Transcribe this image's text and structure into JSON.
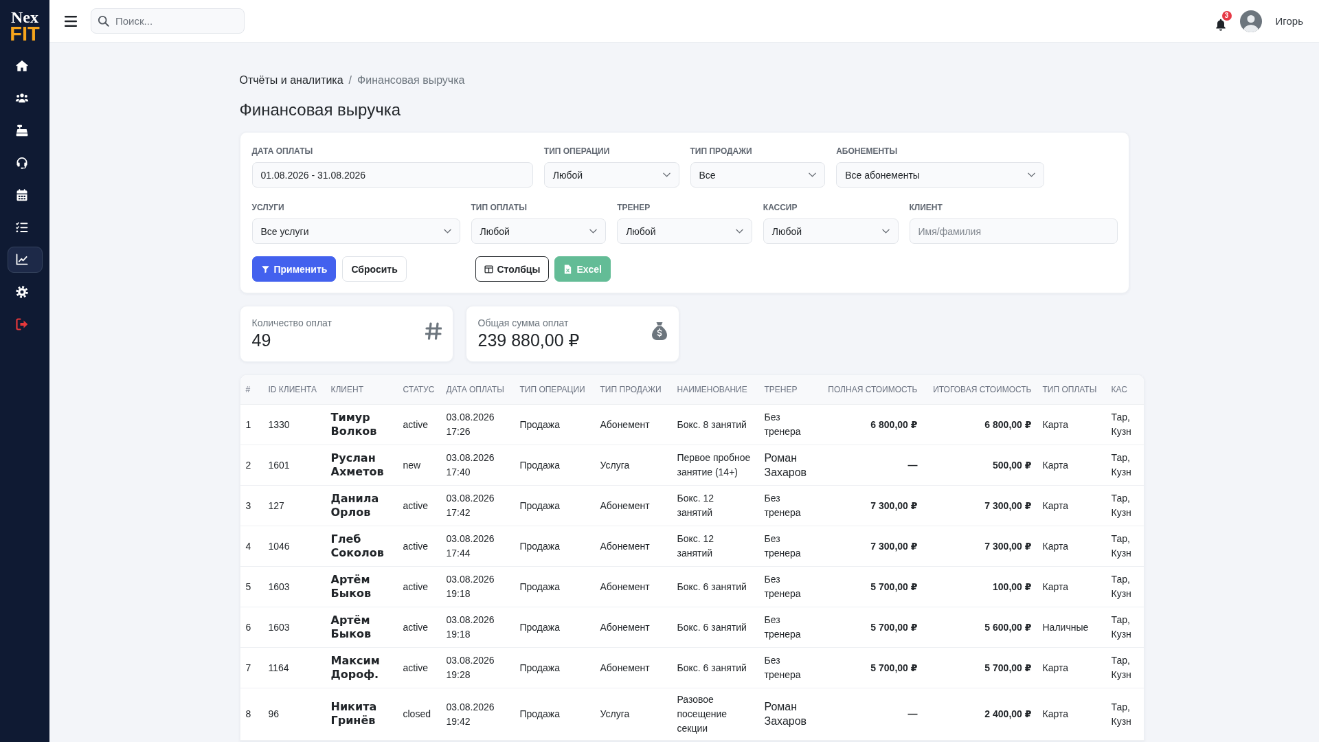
{
  "sidebar": {
    "logo": {
      "line_1": "Nex",
      "line_2": "FIT"
    },
    "items": [
      {
        "kind": "nav",
        "selected": false
      },
      {
        "kind": "nav",
        "selected": false
      },
      {
        "kind": "nav",
        "selected": false
      },
      {
        "kind": "nav",
        "selected": false
      },
      {
        "kind": "nav",
        "selected": false
      },
      {
        "kind": "nav",
        "selected": false
      },
      {
        "kind": "nav",
        "selected": true
      },
      {
        "kind": "nav",
        "selected": false
      },
      {
        "kind": "exit",
        "selected": false
      }
    ]
  },
  "header": {
    "search": {
      "placeholder": "Поиск..."
    },
    "notifications": {
      "count": "3"
    },
    "user": {
      "name": "Игорь"
    }
  },
  "breadcrumb": {
    "items": [
      "Отчёты и аналитика",
      "Финансовая выручка"
    ],
    "separator": "/"
  },
  "title": "Финансовая выручка",
  "filters": {
    "rows": [
      [
        {
          "label": "ДАТА ОПЛАТЫ",
          "kind": "input",
          "value": "01.08.2026 - 31.08.2026"
        },
        {
          "label": "ТИП ОПЕРАЦИИ",
          "kind": "select",
          "value": "Любой"
        },
        {
          "label": "ТИП ПРОДАЖИ",
          "kind": "select",
          "value": "Все"
        },
        {
          "label": "АБОНЕМЕНТЫ",
          "kind": "select",
          "value": "Все абонементы"
        }
      ],
      [
        {
          "label": "УСЛУГИ",
          "kind": "select",
          "value": "Все услуги"
        },
        {
          "label": "ТИП ОПЛАТЫ",
          "kind": "select",
          "value": "Любой"
        },
        {
          "label": "ТРЕНЕР",
          "kind": "select",
          "value": "Любой"
        },
        {
          "label": "КАССИР",
          "kind": "select",
          "value": "Любой"
        },
        {
          "label": "КЛИЕНТ",
          "kind": "input",
          "placeholder": "Имя/фамилия"
        }
      ]
    ],
    "buttons": [
      {
        "label": "Применить",
        "kind": "primary",
        "disabled": false
      },
      {
        "label": "Сбросить",
        "kind": "secondary",
        "disabled": false
      },
      {
        "label": "Столбцы",
        "kind": "outline",
        "disabled": false
      },
      {
        "label": "Excel",
        "kind": "success",
        "disabled": true
      }
    ]
  },
  "stats": [
    {
      "kind": "count",
      "label": "Количество оплат",
      "value": "49"
    },
    {
      "kind": "sum",
      "label": "Общая сумма оплат",
      "value": "239 880,00 ₽"
    }
  ],
  "table": {
    "columns": [
      "#",
      "ID КЛИЕНТА",
      "КЛИЕНТ",
      "СТАТУС",
      "ДАТА ОПЛАТЫ",
      "ТИП ОПЕРАЦИИ",
      "ТИП ПРОДАЖИ",
      "НАИМЕНОВАНИЕ",
      "ТРЕНЕР",
      "ПОЛНАЯ СТОИМОСТЬ",
      "ИТОГОВАЯ СТОИМОСТЬ",
      "ТИП ОПЛАТЫ",
      "КАС"
    ],
    "rows": [
      {
        "n": "1",
        "client_id": "1330",
        "client": "Тимур Волков",
        "status": "active",
        "date": "03.08.2026 17:26",
        "operation": "Продажа",
        "sale_type": "Абонемент",
        "item": "Бокс. 8 занятий",
        "trainer": "Без тренера",
        "trainer_assigned": false,
        "full_price": "6 800,00 ₽",
        "final_price": "6 800,00 ₽",
        "payment": "Карта",
        "cashier": "Тар, Кузн"
      },
      {
        "n": "2",
        "client_id": "1601",
        "client": "Руслан Ахметов",
        "status": "new",
        "date": "03.08.2026 17:40",
        "operation": "Продажа",
        "sale_type": "Услуга",
        "item": "Первое пробное занятие (14+)",
        "trainer": "Роман Захаров",
        "trainer_assigned": true,
        "full_price": "—",
        "final_price": "500,00 ₽",
        "payment": "Карта",
        "cashier": "Тар, Кузн"
      },
      {
        "n": "3",
        "client_id": "127",
        "client": "Данила Орлов",
        "status": "active",
        "date": "03.08.2026 17:42",
        "operation": "Продажа",
        "sale_type": "Абонемент",
        "item": "Бокс. 12 занятий",
        "trainer": "Без тренера",
        "trainer_assigned": false,
        "full_price": "7 300,00 ₽",
        "final_price": "7 300,00 ₽",
        "payment": "Карта",
        "cashier": "Тар, Кузн"
      },
      {
        "n": "4",
        "client_id": "1046",
        "client": "Глеб Соколов",
        "status": "active",
        "date": "03.08.2026 17:44",
        "operation": "Продажа",
        "sale_type": "Абонемент",
        "item": "Бокс. 12 занятий",
        "trainer": "Без тренера",
        "trainer_assigned": false,
        "full_price": "7 300,00 ₽",
        "final_price": "7 300,00 ₽",
        "payment": "Карта",
        "cashier": "Тар, Кузн"
      },
      {
        "n": "5",
        "client_id": "1603",
        "client": "Артём Быков",
        "status": "active",
        "date": "03.08.2026 19:18",
        "operation": "Продажа",
        "sale_type": "Абонемент",
        "item": "Бокс. 6 занятий",
        "trainer": "Без тренера",
        "trainer_assigned": false,
        "full_price": "5 700,00 ₽",
        "final_price": "100,00 ₽",
        "payment": "Карта",
        "cashier": "Тар, Кузн"
      },
      {
        "n": "6",
        "client_id": "1603",
        "client": "Артём Быков",
        "status": "active",
        "date": "03.08.2026 19:18",
        "operation": "Продажа",
        "sale_type": "Абонемент",
        "item": "Бокс. 6 занятий",
        "trainer": "Без тренера",
        "trainer_assigned": false,
        "full_price": "5 700,00 ₽",
        "final_price": "5 600,00 ₽",
        "payment": "Наличные",
        "cashier": "Тар, Кузн"
      },
      {
        "n": "7",
        "client_id": "1164",
        "client": "Максим Дороф.",
        "status": "active",
        "date": "03.08.2026 19:28",
        "operation": "Продажа",
        "sale_type": "Абонемент",
        "item": "Бокс. 6 занятий",
        "trainer": "Без тренера",
        "trainer_assigned": false,
        "full_price": "5 700,00 ₽",
        "final_price": "5 700,00 ₽",
        "payment": "Карта",
        "cashier": "Тар, Кузн"
      },
      {
        "n": "8",
        "client_id": "96",
        "client": "Никита Гринёв",
        "status": "closed",
        "date": "03.08.2026 19:42",
        "operation": "Продажа",
        "sale_type": "Услуга",
        "item": "Разовое посещение секции",
        "trainer": "Роман Захаров",
        "trainer_assigned": true,
        "full_price": "—",
        "final_price": "2 400,00 ₽",
        "payment": "Карта",
        "cashier": "Тар, Кузн"
      }
    ]
  }
}
